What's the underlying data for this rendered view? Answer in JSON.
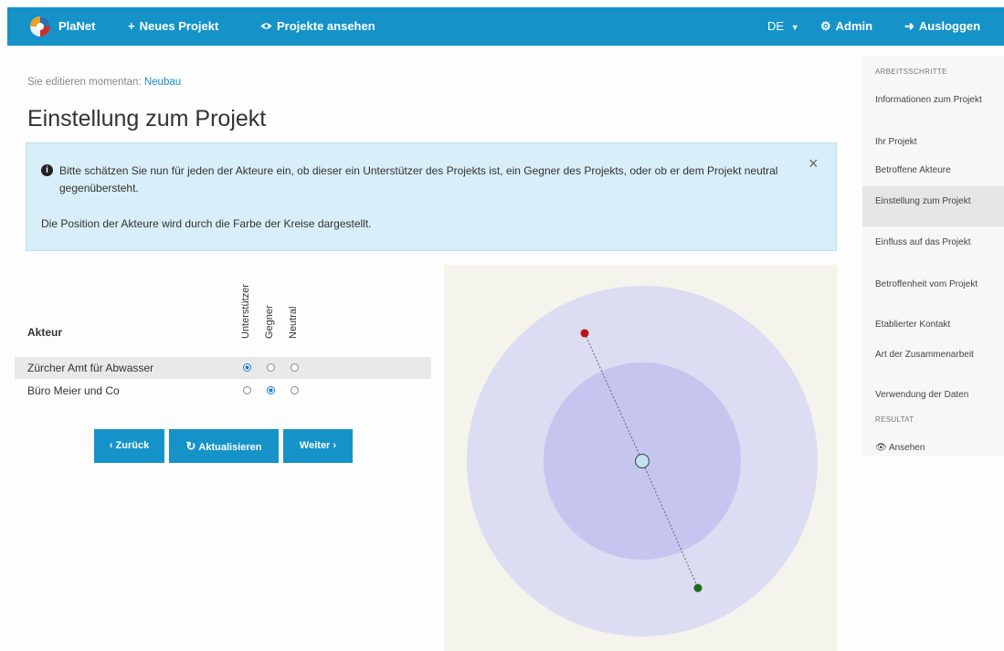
{
  "navbar": {
    "brand": "PlaNet",
    "new_project": "Neues Projekt",
    "new_project_icon": "plus-icon",
    "view_projects": "Projekte ansehen",
    "view_projects_icon": "eye-icon",
    "language": "DE",
    "admin": "Admin",
    "admin_icon": "gear-icon",
    "logout": "Ausloggen",
    "logout_icon": "logout-icon",
    "color": "#1593c8"
  },
  "main": {
    "editing_prefix": "Sie editieren momentan:",
    "editing_project": "Neubau",
    "title": "Einstellung zum Projekt",
    "alert": {
      "text1": "Bitte schätzen Sie nun für jeden der Akteure ein, ob dieser ein Unterstützer des Projekts ist, ein Gegner des Projekts, oder ob er dem Projekt neutral gegenübersteht.",
      "text2": "Die Position der Akteure wird durch die Farbe der Kreise dargestellt.",
      "close": "×"
    },
    "table": {
      "akteur_header": "Akteur",
      "columns": [
        "Unterstützer",
        "Gegner",
        "Neutral"
      ],
      "rows": [
        {
          "name": "Zürcher Amt für Abwasser",
          "selected": "Unterstützer"
        },
        {
          "name": "Büro Meier und Co",
          "selected": "Gegner"
        }
      ]
    },
    "buttons": {
      "back": "‹ Zurück",
      "refresh": "Aktualisieren",
      "next": "Weiter ›"
    }
  },
  "sidebar": {
    "section1": "ARBEITSSCHRITTE",
    "items": [
      "Informationen zum Projekt",
      "Ihr Projekt",
      "Betroffene Akteure",
      "Einstellung zum Projekt",
      "Einfluss auf das Projekt",
      "Betroffenheit vom Projekt",
      "Etablierter Kontakt",
      "Art der Zusammenarbeit",
      "Verwendung der Daten"
    ],
    "active": "Einstellung zum Projekt",
    "section2": "RESULTAT",
    "result_item": "Ansehen"
  },
  "diagram": {
    "colors": {
      "outer": "#dcdcf2",
      "inner": "#c5c5ef",
      "center_node": "#bfe3ee",
      "opponent": "#b81414",
      "supporter": "#1a6e1a"
    }
  }
}
